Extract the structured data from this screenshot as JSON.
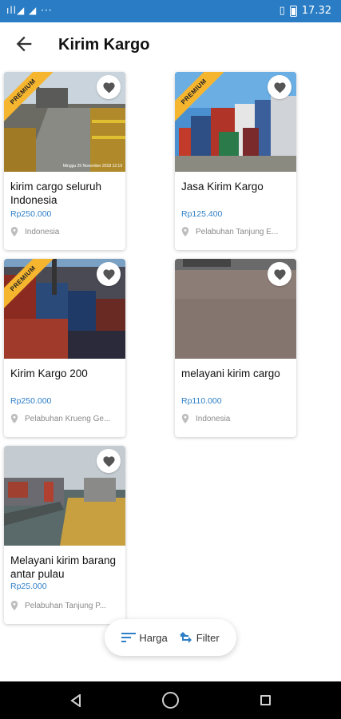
{
  "status_bar": {
    "left_icons": "ıll◢ ◢ ···",
    "time": "17.32"
  },
  "header": {
    "title": "Kirim Kargo"
  },
  "listings": [
    {
      "name": "kirim cargo seluruh Indonesia",
      "price": "Rp250.000",
      "location": "Indonesia",
      "badge": "PREMIUM",
      "photo_caption": "Minggu 25 November 2018 12:19"
    },
    {
      "name": "Jasa Kirim Kargo",
      "price": "Rp125.400",
      "location": "Pelabuhan Tanjung E...",
      "badge": "PREMIUM"
    },
    {
      "name": "Kirim Kargo 200",
      "price": "Rp250.000",
      "location": "Pelabuhan Krueng Ge...",
      "badge": "PREMIUM"
    },
    {
      "name": "melayani kirim cargo",
      "price": "Rp110.000",
      "location": "Indonesia"
    },
    {
      "name": "Melayani kirim barang antar pulau",
      "price": "Rp25.000",
      "location": "Pelabuhan Tanjung P..."
    }
  ],
  "sort_bar": {
    "price_label": "Harga",
    "filter_label": "Filter"
  },
  "colors": {
    "status_bar": "#2a7dc4",
    "price": "#2f7fc6",
    "badge": "#f6b52f"
  }
}
